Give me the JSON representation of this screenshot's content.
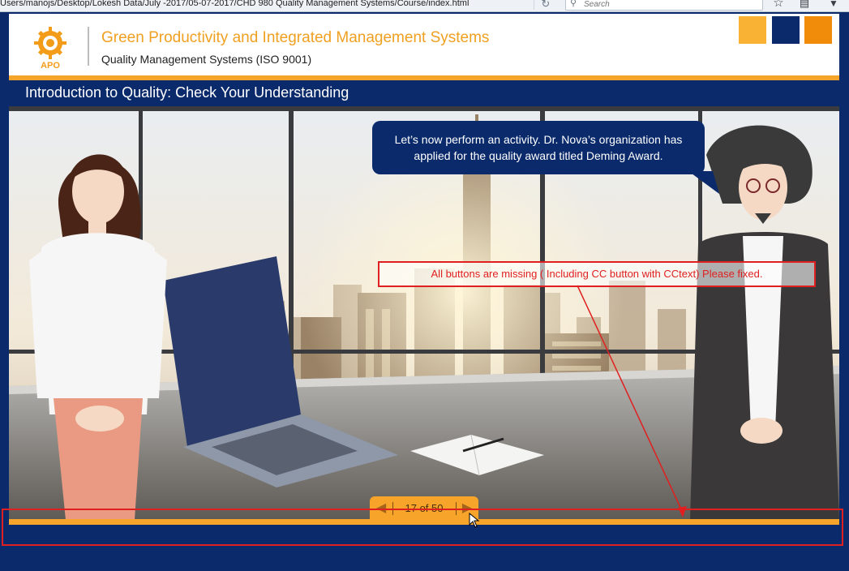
{
  "browser": {
    "url": "Users/manojs/Desktop/Lokesh Data/July -2017/05-07-2017/CHD 980 Quality Management Systems/Course/index.html",
    "search_placeholder": "Search",
    "icons": [
      "reload-icon",
      "search-icon",
      "bookmark-star-icon",
      "reader-icon",
      "pocket-icon"
    ]
  },
  "header": {
    "logo_text": "APO",
    "course_title": "Green Productivity and Integrated Management Systems",
    "course_subtitle": "Quality Management Systems (ISO 9001)",
    "squares": [
      "#f9b233",
      "#0a2a6b",
      "#f08c0a"
    ]
  },
  "page": {
    "title": "Introduction to Quality: Check Your Understanding"
  },
  "dialogue": {
    "bubble_text": "Let’s now perform an activity. Dr. Nova’s organization has applied for the quality award titled Deming Award."
  },
  "annotation": {
    "text": "All buttons are missing ( Including CC button with CCtext) Please fixed.",
    "color": "#e02020"
  },
  "pager": {
    "current": 17,
    "total": 50,
    "label": "17 of 50"
  },
  "colors": {
    "navy": "#0a2a6b",
    "orange": "#f6a52a",
    "accent": "#f0a020"
  }
}
